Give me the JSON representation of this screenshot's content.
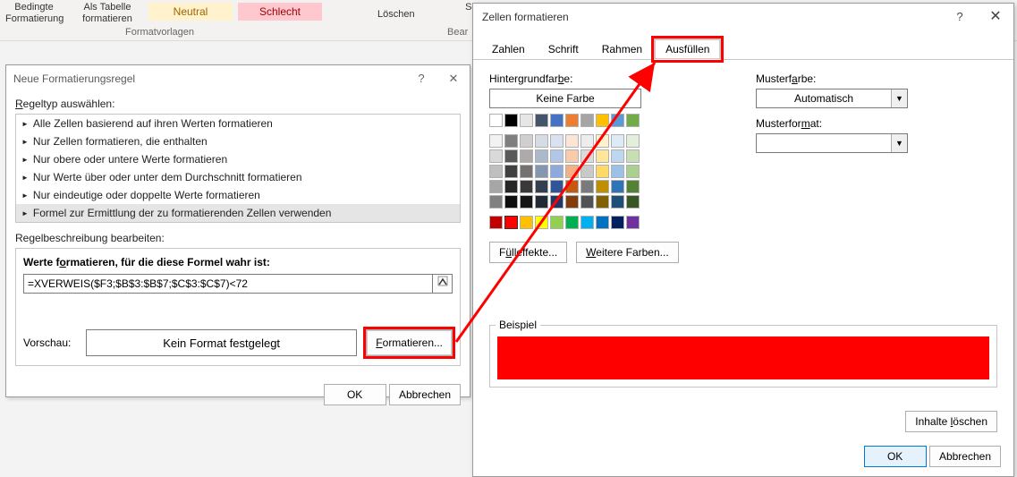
{
  "ribbon": {
    "bedingte": "Bedingte\nFormatierung",
    "alsTabelle": "Als Tabelle\nformatieren",
    "neutral": "Neutral",
    "schlecht": "Schlecht",
    "formatvorlagen": "Formatvorlagen",
    "loeschen": "Löschen",
    "sortieren": "Sortieren und Suchen und",
    "bear": "Bear"
  },
  "dlg1": {
    "title": "Neue Formatierungsregel",
    "ruletype_label": "Regeltyp auswählen:",
    "rules": [
      "Alle Zellen basierend auf ihren Werten formatieren",
      "Nur Zellen formatieren, die enthalten",
      "Nur obere oder untere Werte formatieren",
      "Nur Werte über oder unter dem Durchschnitt formatieren",
      "Nur eindeutige oder doppelte Werte formatieren",
      "Formel zur Ermittlung der zu formatierenden Zellen verwenden"
    ],
    "ruledesc_label": "Regelbeschreibung bearbeiten:",
    "formula_label": "Werte formatieren, für die diese Formel wahr ist:",
    "formula_value": "=XVERWEIS($F3;$B$3:$B$7;$C$3:$C$7)<72",
    "preview_label": "Vorschau:",
    "preview_text": "Kein Format festgelegt",
    "format_btn": "Formatieren...",
    "ok": "OK",
    "cancel": "Abbrechen"
  },
  "dlg2": {
    "title": "Zellen formatieren",
    "tabs": [
      "Zahlen",
      "Schrift",
      "Rahmen",
      "Ausfüllen"
    ],
    "active_tab_index": 3,
    "bgcolor_label": "Hintergrundfarbe:",
    "nocolor": "Keine Farbe",
    "fill_effects": "Fülleffekte...",
    "more_colors": "Weitere Farben...",
    "mustercolor_label": "Musterfarbe:",
    "mustercolor_value": "Automatisch",
    "musterformat_label": "Musterformat:",
    "beispiel_label": "Beispiel",
    "sample_color": "#ff0000",
    "clear_btn": "Inhalte löschen",
    "ok": "OK",
    "cancel": "Abbrechen"
  },
  "palette": {
    "row_nocolor_plus_theme1": [
      "#ffffff",
      "#000000",
      "#e7e6e6",
      "#44546a",
      "#4472c4",
      "#ed7d31",
      "#a5a5a5",
      "#ffc000",
      "#5b9bd5",
      "#70ad47"
    ],
    "theme_shades": [
      [
        "#f2f2f2",
        "#7f7f7f",
        "#d0cece",
        "#d6dce5",
        "#d9e1f2",
        "#fce4d6",
        "#ededed",
        "#fff2cc",
        "#ddebf7",
        "#e2efda"
      ],
      [
        "#d9d9d9",
        "#595959",
        "#aeaaaa",
        "#acb9ca",
        "#b4c6e7",
        "#f8cbad",
        "#dbdbdb",
        "#ffe699",
        "#bdd7ee",
        "#c6e0b4"
      ],
      [
        "#bfbfbf",
        "#404040",
        "#767171",
        "#8497b0",
        "#8ea9db",
        "#f4b084",
        "#c9c9c9",
        "#ffd966",
        "#9bc2e6",
        "#a9d08e"
      ],
      [
        "#a6a6a6",
        "#262626",
        "#3a3838",
        "#333f4f",
        "#305496",
        "#c65911",
        "#7b7b7b",
        "#bf8f00",
        "#2f75b5",
        "#548235"
      ],
      [
        "#808080",
        "#0d0d0d",
        "#161616",
        "#222b35",
        "#203764",
        "#833c0c",
        "#525252",
        "#806000",
        "#1f4e78",
        "#375623"
      ]
    ],
    "standard": [
      "#c00000",
      "#ff0000",
      "#ffc000",
      "#ffff00",
      "#92d050",
      "#00b050",
      "#00b0f0",
      "#0070c0",
      "#002060",
      "#7030a0"
    ],
    "selected_standard_index": 1
  }
}
